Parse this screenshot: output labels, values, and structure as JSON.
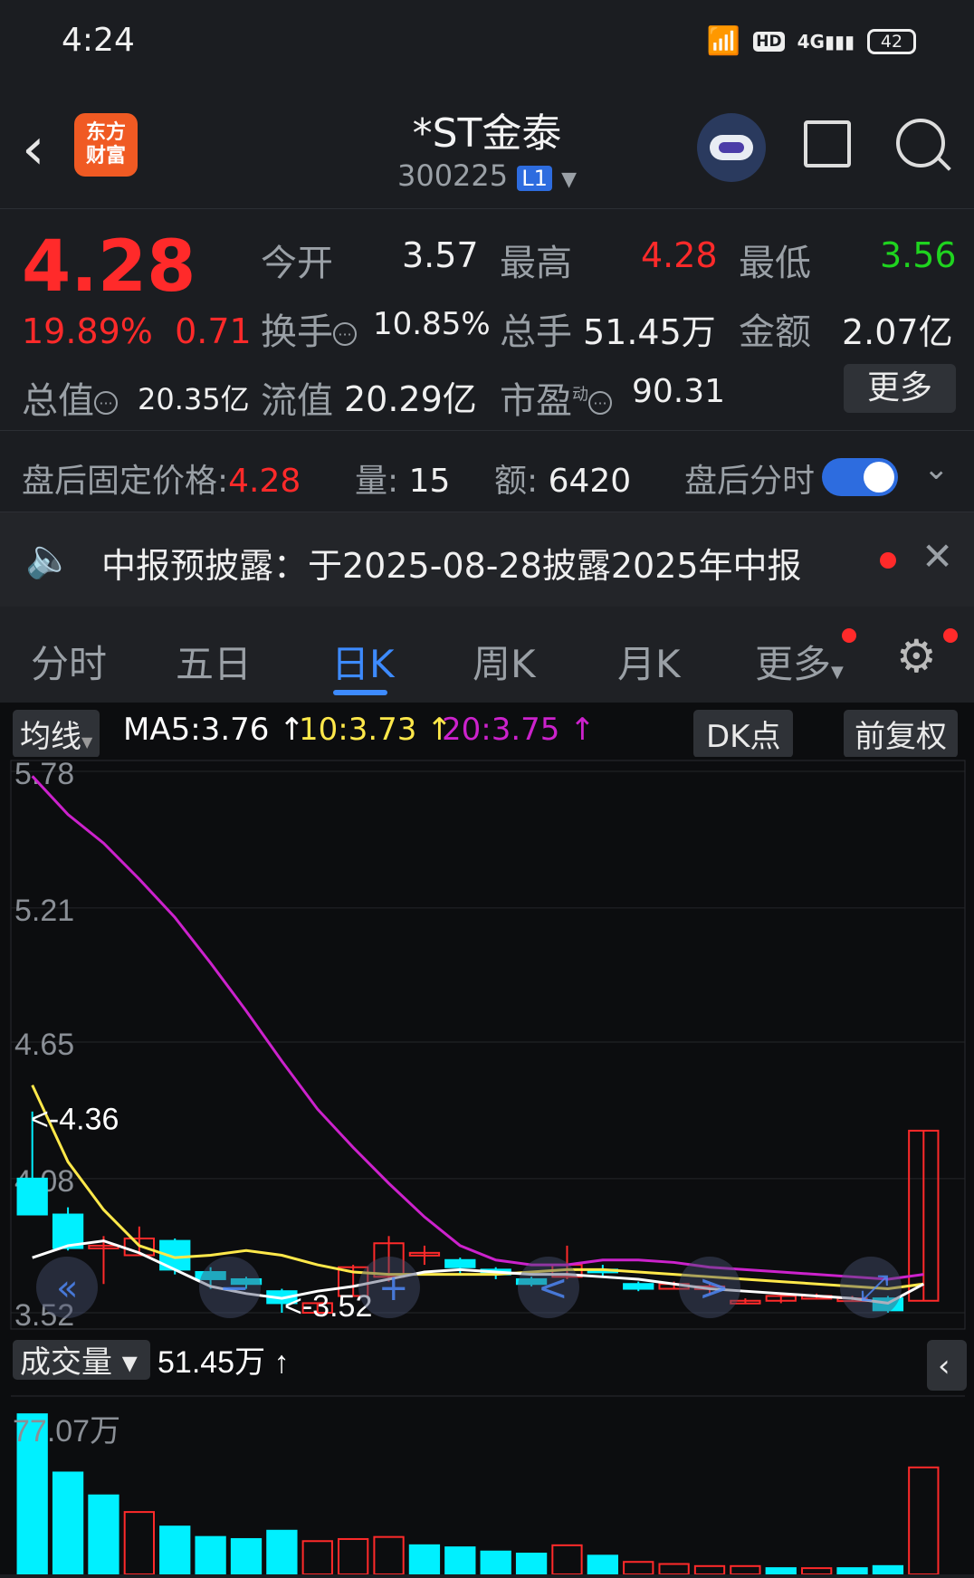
{
  "status": {
    "time": "4:24",
    "hd": "HD",
    "network": "4G",
    "battery": "42"
  },
  "header": {
    "logo": [
      "东方",
      "财富"
    ],
    "title": "*ST金泰",
    "code": "300225",
    "level": "L1"
  },
  "quote": {
    "price": "4.28",
    "change_pct": "19.89%",
    "change": "0.71",
    "open_label": "今开",
    "open": "3.57",
    "high_label": "最高",
    "high": "4.28",
    "low_label": "最低",
    "low": "3.56",
    "turnover_label": "换手",
    "turnover": "10.85%",
    "volume_label": "总手",
    "volume": "51.45万",
    "amount_label": "金额",
    "amount": "2.07亿",
    "mktcap_label": "总值",
    "mktcap": "20.35亿",
    "float_label": "流值",
    "float": "20.29亿",
    "pe_label": "市盈",
    "pe_sup": "动",
    "pe": "90.31",
    "more": "更多"
  },
  "after_hours": {
    "label": "盘后固定价格:",
    "price": "4.28",
    "vol_label": "量:",
    "vol": "15",
    "amt_label": "额:",
    "amt": "6420",
    "fs_label": "盘后分时"
  },
  "notice": {
    "text": "中报预披露：于2025-08-28披露2025年中报"
  },
  "tabs": [
    "分时",
    "五日",
    "日K",
    "周K",
    "月K",
    "更多"
  ],
  "active_tab": 2,
  "chart_header": {
    "ma_select": "均线",
    "ma5": "MA5:3.76",
    "ma10": "10:3.73",
    "ma20": "20:3.75",
    "dk": "DK点",
    "adjust": "前复权"
  },
  "colors": {
    "up": "#ff2a2a",
    "down": "#00f0ff",
    "ma5": "#ffffff",
    "ma10": "#ffe84a",
    "ma20": "#cc22cc",
    "accent": "#3d8bff"
  },
  "chart_data": {
    "type": "candlestick",
    "y_ticks": [
      "5.78",
      "5.21",
      "4.65",
      "4.08",
      "3.52"
    ],
    "ylim": [
      3.52,
      5.78
    ],
    "annotations": {
      "high": "<-4.36",
      "low": "<-3.52"
    },
    "candles": [
      {
        "o": 4.08,
        "c": 3.93,
        "h": 4.36,
        "l": 3.93
      },
      {
        "o": 3.93,
        "c": 3.79,
        "h": 3.96,
        "l": 3.78
      },
      {
        "o": 3.8,
        "c": 3.8,
        "h": 3.84,
        "l": 3.64
      },
      {
        "o": 3.76,
        "c": 3.83,
        "h": 3.88,
        "l": 3.76
      },
      {
        "o": 3.82,
        "c": 3.7,
        "h": 3.83,
        "l": 3.68
      },
      {
        "o": 3.69,
        "c": 3.66,
        "h": 3.71,
        "l": 3.62
      },
      {
        "o": 3.66,
        "c": 3.64,
        "h": 3.67,
        "l": 3.62
      },
      {
        "o": 3.61,
        "c": 3.56,
        "h": 3.62,
        "l": 3.52
      },
      {
        "o": 3.52,
        "c": 3.56,
        "h": 3.56,
        "l": 3.52
      },
      {
        "o": 3.59,
        "c": 3.71,
        "h": 3.72,
        "l": 3.59
      },
      {
        "o": 3.67,
        "c": 3.81,
        "h": 3.84,
        "l": 3.65
      },
      {
        "o": 3.77,
        "c": 3.77,
        "h": 3.8,
        "l": 3.72
      },
      {
        "o": 3.74,
        "c": 3.71,
        "h": 3.75,
        "l": 3.68
      },
      {
        "o": 3.7,
        "c": 3.68,
        "h": 3.71,
        "l": 3.66
      },
      {
        "o": 3.66,
        "c": 3.64,
        "h": 3.67,
        "l": 3.63
      },
      {
        "o": 3.67,
        "c": 3.72,
        "h": 3.8,
        "l": 3.66
      },
      {
        "o": 3.7,
        "c": 3.69,
        "h": 3.72,
        "l": 3.67
      },
      {
        "o": 3.64,
        "c": 3.62,
        "h": 3.65,
        "l": 3.61
      },
      {
        "o": 3.62,
        "c": 3.64,
        "h": 3.65,
        "l": 3.62
      },
      {
        "o": 3.62,
        "c": 3.63,
        "h": 3.64,
        "l": 3.6
      },
      {
        "o": 3.57,
        "c": 3.57,
        "h": 3.58,
        "l": 3.56
      },
      {
        "o": 3.57,
        "c": 3.59,
        "h": 3.6,
        "l": 3.56
      },
      {
        "o": 3.59,
        "c": 3.59,
        "h": 3.6,
        "l": 3.58
      },
      {
        "o": 3.58,
        "c": 3.58,
        "h": 3.59,
        "l": 3.57
      },
      {
        "o": 3.58,
        "c": 3.53,
        "h": 3.59,
        "l": 3.52
      },
      {
        "o": 3.57,
        "c": 4.28,
        "h": 4.28,
        "l": 3.57
      }
    ],
    "ma5": [
      3.75,
      3.8,
      3.82,
      3.77,
      3.7,
      3.63,
      3.6,
      3.58,
      3.61,
      3.63,
      3.66,
      3.69,
      3.7,
      3.69,
      3.68,
      3.68,
      3.67,
      3.66,
      3.64,
      3.62,
      3.61,
      3.6,
      3.59,
      3.58,
      3.56,
      3.64
    ],
    "ma10": [
      4.47,
      4.15,
      3.95,
      3.8,
      3.75,
      3.76,
      3.78,
      3.76,
      3.72,
      3.69,
      3.68,
      3.68,
      3.68,
      3.68,
      3.69,
      3.7,
      3.7,
      3.69,
      3.68,
      3.67,
      3.66,
      3.65,
      3.64,
      3.63,
      3.62,
      3.64
    ],
    "ma20": [
      5.76,
      5.6,
      5.48,
      5.33,
      5.17,
      4.98,
      4.78,
      4.57,
      4.37,
      4.21,
      4.06,
      3.92,
      3.8,
      3.74,
      3.72,
      3.72,
      3.74,
      3.74,
      3.73,
      3.71,
      3.7,
      3.69,
      3.68,
      3.67,
      3.66,
      3.68
    ],
    "volume": {
      "label": "成交量",
      "current": "51.45万",
      "max_label": "77.07万",
      "max": 77.07,
      "values": [
        77,
        49,
        38,
        30,
        23,
        18,
        17,
        21,
        16,
        17,
        18,
        14,
        13,
        11,
        10,
        14,
        9,
        6,
        5,
        4,
        4,
        3,
        3,
        3,
        4,
        51.45
      ],
      "up": [
        false,
        false,
        false,
        true,
        false,
        false,
        false,
        false,
        true,
        true,
        true,
        false,
        false,
        false,
        false,
        true,
        false,
        true,
        true,
        true,
        true,
        false,
        true,
        false,
        false,
        true
      ]
    }
  }
}
